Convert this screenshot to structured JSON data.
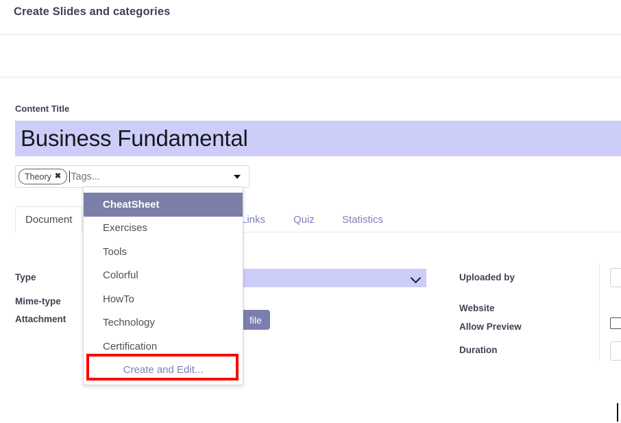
{
  "header": {
    "title": "Create Slides and categories"
  },
  "content_title": {
    "label": "Content Title",
    "value": "Business Fundamental"
  },
  "tags": {
    "chip_label": "Theory",
    "chip_remove_icon": "✖",
    "placeholder": "Tags...",
    "caret_icon": "chevron-down-icon"
  },
  "tabs": [
    {
      "label": "Document",
      "active": true
    },
    {
      "label": "Links",
      "active": false
    },
    {
      "label": "Quiz",
      "active": false
    },
    {
      "label": "Statistics",
      "active": false
    }
  ],
  "form_left": {
    "type_label": "Type",
    "type_value": "",
    "mime_label": "Mime-type",
    "mime_value": "",
    "attachment_label": "Attachment",
    "file_button": "file"
  },
  "form_right": {
    "uploaded_by_label": "Uploaded by",
    "uploaded_by_value": "",
    "website_label": "Website",
    "allow_preview_label": "Allow Preview",
    "allow_preview_checked": false,
    "duration_label": "Duration",
    "duration_value": ""
  },
  "dropdown": {
    "options": [
      "CheatSheet",
      "Exercises",
      "Tools",
      "Colorful",
      "HowTo",
      "Technology",
      "Certification"
    ],
    "selected_index": 0,
    "create_and_edit": "Create and Edit..."
  },
  "colors": {
    "highlight": "#7b7fa8",
    "field_lavender": "#cdcdfa",
    "accent_purple": "#7c7fb8",
    "annotation_red": "#fc0000",
    "text_dark": "#3d4251"
  }
}
